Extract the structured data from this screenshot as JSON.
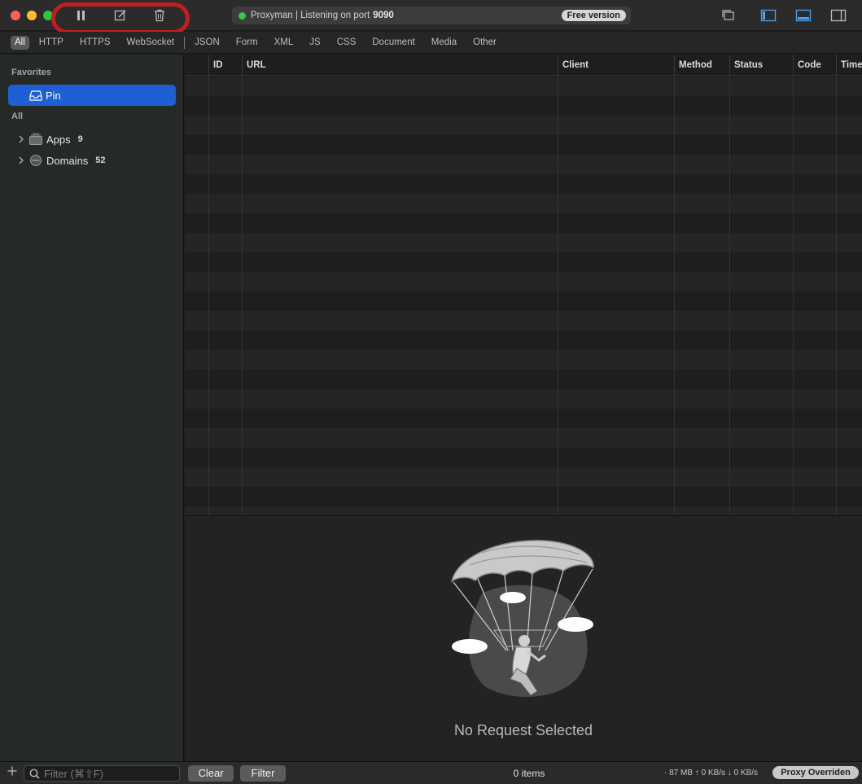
{
  "titlebar": {
    "status_text": "Proxyman | Listening on port",
    "port": "9090",
    "version_badge": "Free version",
    "status_color": "#33c748"
  },
  "filter_tabs": [
    "All",
    "HTTP",
    "HTTPS",
    "WebSocket",
    "JSON",
    "Form",
    "XML",
    "JS",
    "CSS",
    "Document",
    "Media",
    "Other"
  ],
  "sidebar": {
    "favorites_label": "Favorites",
    "pin_label": "Pin",
    "all_label": "All",
    "apps_label": "Apps",
    "apps_count": "9",
    "domains_label": "Domains",
    "domains_count": "52"
  },
  "table": {
    "columns": [
      "ID",
      "URL",
      "Client",
      "Method",
      "Status",
      "Code",
      "Time"
    ]
  },
  "detail": {
    "empty_text": "No Request Selected"
  },
  "bottombar": {
    "filter_placeholder": "Filter (⌘⇧F)",
    "clear_label": "Clear",
    "filter_label": "Filter",
    "item_count": "0 items",
    "stats": "· 87 MB ↑ 0 KB/s ↓ 0 KB/s",
    "proxy_badge": "Proxy Overriden"
  },
  "colors": {
    "accent": "#1e5fd6",
    "annotation_ring": "#c41d1d"
  }
}
